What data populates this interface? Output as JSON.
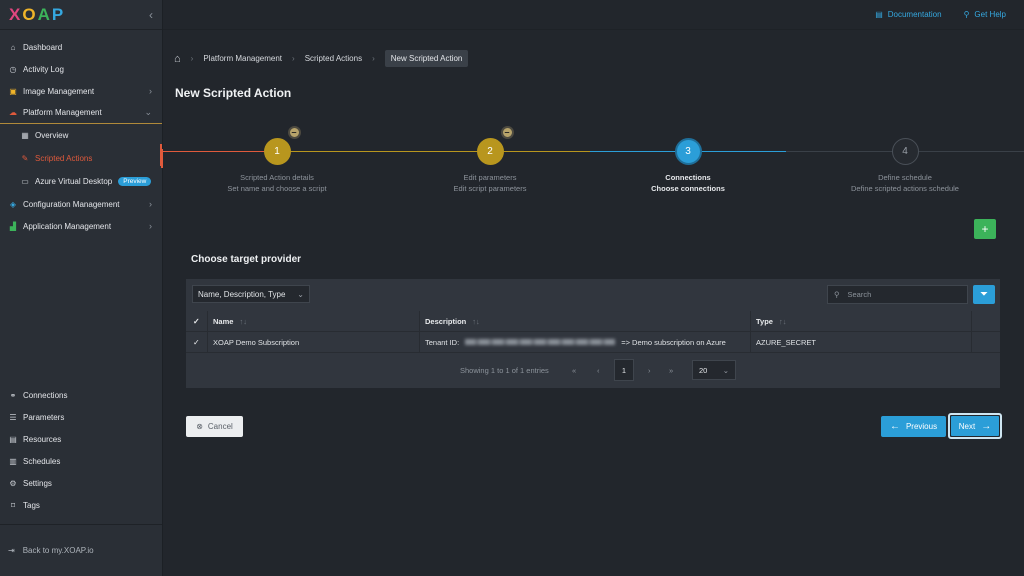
{
  "app": {
    "logo_letters": [
      "X",
      "O",
      "A",
      "P"
    ],
    "logo_colors": [
      "#e0467f",
      "#f0b429",
      "#3cb35a",
      "#35a8e0"
    ]
  },
  "sidebar": {
    "items": [
      {
        "label": "Dashboard",
        "icon": "home-icon"
      },
      {
        "label": "Activity Log",
        "icon": "clock-icon"
      },
      {
        "label": "Image Management",
        "icon": "images-icon"
      },
      {
        "label": "Platform Management",
        "icon": "cloud-icon"
      },
      {
        "label": "Overview",
        "icon": "grid-icon"
      },
      {
        "label": "Scripted Actions",
        "icon": "pencil-icon"
      },
      {
        "label": "Azure Virtual Desktop",
        "icon": "monitor-icon",
        "badge": "Preview"
      },
      {
        "label": "Configuration Management",
        "icon": "layers-icon"
      },
      {
        "label": "Application Management",
        "icon": "chart-icon"
      }
    ],
    "bottom_items": [
      {
        "label": "Connections",
        "icon": "link-icon"
      },
      {
        "label": "Parameters",
        "icon": "list-icon"
      },
      {
        "label": "Resources",
        "icon": "box-icon"
      },
      {
        "label": "Schedules",
        "icon": "calendar-icon"
      },
      {
        "label": "Settings",
        "icon": "gear-icon"
      },
      {
        "label": "Tags",
        "icon": "tag-icon"
      }
    ],
    "back_label": "Back to my.XOAP.io"
  },
  "topbar": {
    "documentation": "Documentation",
    "get_help": "Get Help"
  },
  "breadcrumb": {
    "items": [
      "Platform Management",
      "Scripted Actions",
      "New Scripted Action"
    ]
  },
  "page": {
    "title": "New Scripted Action"
  },
  "stepper": {
    "steps": [
      {
        "number": "1",
        "title": "Scripted Action details",
        "subtitle": "Set name and choose a script",
        "state": "completed"
      },
      {
        "number": "2",
        "title": "Edit parameters",
        "subtitle": "Edit script parameters",
        "state": "completed"
      },
      {
        "number": "3",
        "title": "Connections",
        "subtitle": "Choose connections",
        "state": "current"
      },
      {
        "number": "4",
        "title": "Define schedule",
        "subtitle": "Define scripted actions schedule",
        "state": "pending"
      }
    ]
  },
  "section": {
    "title": "Choose target provider"
  },
  "table": {
    "filter_value": "Name, Description, Type",
    "search_placeholder": "Search",
    "columns": [
      "Name",
      "Description",
      "Type"
    ],
    "rows": [
      {
        "name": "XOAP Demo Subscription",
        "description_prefix": "Tenant ID:",
        "description_suffix": "=> Demo subscription on Azure",
        "type": "AZURE_SECRET",
        "checked": true
      }
    ],
    "pagination_text": "Showing 1 to 1 of 1 entries",
    "current_page": "1",
    "page_size": "20"
  },
  "buttons": {
    "cancel": "Cancel",
    "previous": "Previous",
    "next": "Next"
  },
  "colors": {
    "accent": "#2b9ed8",
    "completed": "#b8961e",
    "active_nav": "#e05a3c",
    "add": "#3cb35a"
  }
}
